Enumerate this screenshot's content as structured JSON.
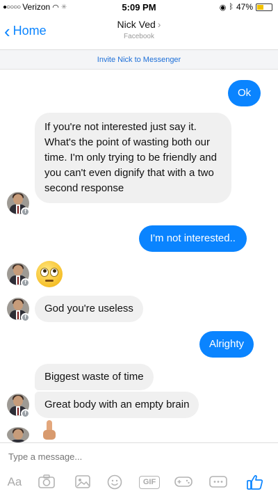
{
  "status_bar": {
    "carrier": "Verizon",
    "time": "5:09 PM",
    "battery_percent": "47%",
    "battery_level": 0.47
  },
  "nav": {
    "back_label": "Home",
    "contact_name": "Nick Ved",
    "subtitle": "Facebook"
  },
  "banner": {
    "invite_text": "Invite Nick to Messenger"
  },
  "messages": [
    {
      "sender": "me",
      "text": "Ok"
    },
    {
      "sender": "Nick Ved",
      "text": "If you're not interested just say it. What's the point of wasting both our time. I'm only trying to be friendly and you can't even dignify that with a two second response"
    },
    {
      "sender": "me",
      "text": "I'm not interested.."
    },
    {
      "sender": "Nick Ved",
      "emoji": "face-with-rolling-eyes"
    },
    {
      "sender": "Nick Ved",
      "text": "God you're useless"
    },
    {
      "sender": "me",
      "text": "Alrighty"
    },
    {
      "sender": "Nick Ved",
      "text": "Biggest waste of time"
    },
    {
      "sender": "Nick Ved",
      "text": "Great body with an empty brain"
    },
    {
      "sender": "Nick Ved",
      "emoji": "middle-finger"
    }
  ],
  "composer": {
    "placeholder": "Type a message...",
    "tools": {
      "aa": "Aa",
      "camera": "camera-icon",
      "gallery": "photo-gallery-icon",
      "emoji": "smiley-icon",
      "gif": "GIF",
      "games": "game-controller-icon",
      "more": "more-icon",
      "like": "thumbs-up-icon"
    }
  },
  "colors": {
    "accent": "#0a84ff",
    "incoming_bubble": "#f0f0f0",
    "outgoing_bubble": "#0a84ff",
    "link": "#1d6fd8"
  }
}
